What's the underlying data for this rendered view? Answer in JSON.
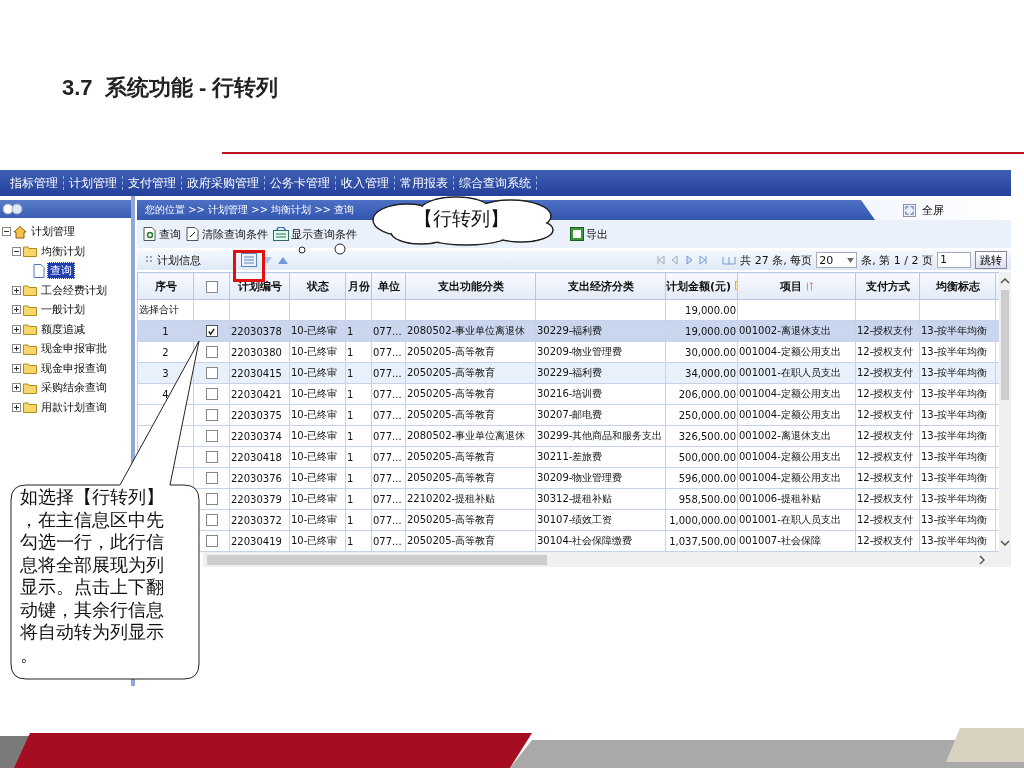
{
  "slide": {
    "title": "3.7  系统功能 - 行转列"
  },
  "app": {
    "menu": [
      "指标管理",
      "计划管理",
      "支付管理",
      "政府采购管理",
      "公务卡管理",
      "收入管理",
      "常用报表",
      "综合查询系统"
    ],
    "sidebar": {
      "tree": [
        {
          "label": "计划管理",
          "kind": "root",
          "expanded": true,
          "selected": false,
          "children": [
            {
              "label": "均衡计划",
              "kind": "folder",
              "expanded": true,
              "selected": false,
              "children": [
                {
                  "label": "查询",
                  "kind": "page",
                  "selected": true
                }
              ]
            },
            {
              "label": "工会经费计划",
              "kind": "folder",
              "expanded": false,
              "selected": false
            },
            {
              "label": "一般计划",
              "kind": "folder",
              "expanded": false,
              "selected": false
            },
            {
              "label": "额度追减",
              "kind": "folder",
              "expanded": false,
              "selected": false
            },
            {
              "label": "现金申报审批",
              "kind": "folder",
              "expanded": false,
              "selected": false
            },
            {
              "label": "现金申报查询",
              "kind": "folder",
              "expanded": false,
              "selected": false
            },
            {
              "label": "采购结余查询",
              "kind": "folder",
              "expanded": false,
              "selected": false
            },
            {
              "label": "用款计划查询",
              "kind": "folder",
              "expanded": false,
              "selected": false
            }
          ]
        }
      ]
    },
    "breadcrumb": "您的位置 >> 计划管理 >> 均衡计划 >> 查询",
    "fullscreen": "全屏",
    "toolbar": [
      {
        "label": "查询",
        "kind": "search"
      },
      {
        "label": "清除查询条件",
        "kind": "clear"
      },
      {
        "label": "显示查询条件",
        "kind": "show"
      },
      {
        "label": "导出",
        "kind": "export"
      }
    ],
    "grid": {
      "title": "计划信息",
      "pager": {
        "total_text": "共 27 条, 每页",
        "page_size": "20",
        "mid_text": "条, 第 1 / 2 页",
        "page": "1",
        "go": "跳转"
      },
      "index_header": "序号",
      "select_all": {
        "checked": false
      },
      "columns": [
        {
          "label": "计划编号",
          "kind": "text"
        },
        {
          "label": "状态",
          "kind": "text"
        },
        {
          "label": "月份",
          "kind": "text"
        },
        {
          "label": "单位",
          "kind": "text"
        },
        {
          "label": "支出功能分类",
          "kind": "text"
        },
        {
          "label": "支出经济分类",
          "kind": "text"
        },
        {
          "label": "计划金额(元)",
          "kind": "amount"
        },
        {
          "label": "项目",
          "kind": "sort"
        },
        {
          "label": "支付方式",
          "kind": "text"
        },
        {
          "label": "均衡标志",
          "kind": "text"
        }
      ],
      "summary": {
        "label": "选择合计",
        "amount": "19,000.00"
      },
      "rows": [
        {
          "index": "1",
          "checked": true,
          "selected": true,
          "hover": false,
          "cells": [
            "22030378",
            "10-已终审",
            "1",
            "077...",
            "2080502-事业单位离退休",
            "30229-福利费",
            "19,000.00",
            "001002-离退休支出",
            "12-授权支付",
            "13-按半年均衡"
          ]
        },
        {
          "index": "2",
          "checked": false,
          "selected": false,
          "hover": false,
          "cells": [
            "22030380",
            "10-已终审",
            "1",
            "077...",
            "2050205-高等教育",
            "30209-物业管理费",
            "30,000.00",
            "001004-定额公用支出",
            "12-授权支付",
            "13-按半年均衡"
          ]
        },
        {
          "index": "3",
          "checked": false,
          "selected": false,
          "hover": true,
          "cells": [
            "22030415",
            "10-已终审",
            "1",
            "077...",
            "2050205-高等教育",
            "30229-福利费",
            "34,000.00",
            "001001-在职人员支出",
            "12-授权支付",
            "13-按半年均衡"
          ]
        },
        {
          "index": "4",
          "checked": false,
          "selected": false,
          "hover": false,
          "cells": [
            "22030421",
            "10-已终审",
            "1",
            "077...",
            "2050205-高等教育",
            "30216-培训费",
            "206,000.00",
            "001004-定额公用支出",
            "12-授权支付",
            "13-按半年均衡"
          ]
        },
        {
          "checked": false,
          "selected": false,
          "hover": false,
          "cells": [
            "22030375",
            "10-已终审",
            "1",
            "077...",
            "2050205-高等教育",
            "30207-邮电费",
            "250,000.00",
            "001004-定额公用支出",
            "12-授权支付",
            "13-按半年均衡"
          ]
        },
        {
          "checked": false,
          "selected": false,
          "hover": false,
          "cells": [
            "22030374",
            "10-已终审",
            "1",
            "077...",
            "2080502-事业单位离退休",
            "30299-其他商品和服务支出",
            "326,500.00",
            "001002-离退休支出",
            "12-授权支付",
            "13-按半年均衡"
          ]
        },
        {
          "checked": false,
          "selected": false,
          "hover": false,
          "cells": [
            "22030418",
            "10-已终审",
            "1",
            "077...",
            "2050205-高等教育",
            "30211-差旅费",
            "500,000.00",
            "001004-定额公用支出",
            "12-授权支付",
            "13-按半年均衡"
          ]
        },
        {
          "checked": false,
          "selected": false,
          "hover": false,
          "cells": [
            "22030376",
            "10-已终审",
            "1",
            "077...",
            "2050205-高等教育",
            "30209-物业管理费",
            "596,000.00",
            "001004-定额公用支出",
            "12-授权支付",
            "13-按半年均衡"
          ]
        },
        {
          "checked": false,
          "selected": false,
          "hover": false,
          "cells": [
            "22030379",
            "10-已终审",
            "1",
            "077...",
            "2210202-提租补贴",
            "30312-提租补贴",
            "958,500.00",
            "001006-提租补贴",
            "12-授权支付",
            "13-按半年均衡"
          ]
        },
        {
          "checked": false,
          "selected": false,
          "hover": false,
          "cells": [
            "22030372",
            "10-已终审",
            "1",
            "077...",
            "2050205-高等教育",
            "30107-绩效工资",
            "1,000,000.00",
            "001001-在职人员支出",
            "12-授权支付",
            "13-按半年均衡"
          ]
        },
        {
          "checked": false,
          "selected": false,
          "hover": false,
          "cells": [
            "22030419",
            "10-已终审",
            "1",
            "077...",
            "2050205-高等教育",
            "30104-社会保障缴费",
            "1,037,500.00",
            "001007-社会保障",
            "12-授权支付",
            "13-按半年均衡"
          ]
        }
      ]
    }
  },
  "callouts": {
    "cloud": "【行转列】",
    "note": "如选择【行转列】，在主信息区中先勾选一行，此行信息将全部展现为列显示。点击上下翻动键，其余行信息将自动转为列显示。"
  }
}
